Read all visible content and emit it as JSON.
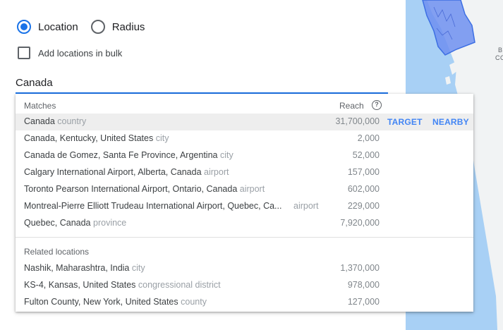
{
  "mode": {
    "location_label": "Location",
    "radius_label": "Radius",
    "selected": "location"
  },
  "bulk": {
    "label": "Add locations in bulk",
    "checked": false
  },
  "search": {
    "value": "Canada"
  },
  "dropdown": {
    "matches_header": "Matches",
    "reach_header": "Reach",
    "help_icon_glyph": "?",
    "target_label": "TARGET",
    "nearby_label": "NEARBY",
    "matches": [
      {
        "name": "Canada",
        "type": "country",
        "reach": "31,700,000"
      },
      {
        "name": "Canada, Kentucky, United States",
        "type": "city",
        "reach": "2,000"
      },
      {
        "name": "Canada de Gomez, Santa Fe Province, Argentina",
        "type": "city",
        "reach": "52,000"
      },
      {
        "name": "Calgary International Airport, Alberta, Canada",
        "type": "airport",
        "reach": "157,000"
      },
      {
        "name": "Toronto Pearson International Airport, Ontario, Canada",
        "type": "airport",
        "reach": "602,000"
      },
      {
        "name": "Montreal-Pierre Elliott Trudeau International Airport, Quebec, Ca...",
        "type": "airport",
        "reach": "229,000"
      },
      {
        "name": "Quebec, Canada",
        "type": "province",
        "reach": "7,920,000"
      }
    ],
    "related_header": "Related locations",
    "related": [
      {
        "name": "Nashik, Maharashtra, India",
        "type": "city",
        "reach": "1,370,000"
      },
      {
        "name": "KS-4, Kansas, United States",
        "type": "congressional district",
        "reach": "978,000"
      },
      {
        "name": "Fulton County, New York, United States",
        "type": "county",
        "reach": "127,000"
      }
    ]
  },
  "map": {
    "labels": [
      "B",
      "CO"
    ],
    "water_color": "#a8d0f5",
    "land_color": "#f1f3f4",
    "highlight_color": "#6f8ff0"
  },
  "colors": {
    "accent": "#1a73e8",
    "button": "#4285f4"
  }
}
